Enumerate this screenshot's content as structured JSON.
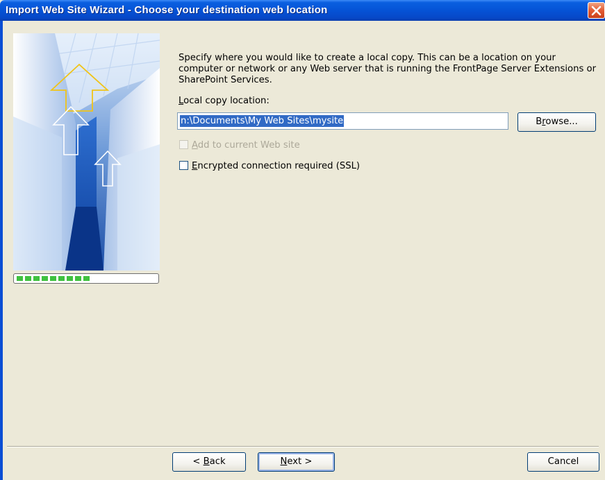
{
  "window": {
    "title": "Import Web Site Wizard - Choose your destination web location",
    "close_icon": "close-icon"
  },
  "progress": {
    "completed_steps": 9,
    "label": "wizard-progress"
  },
  "main": {
    "description": "Specify where you would like to create a local copy.  This can be a location on your computer or network or any Web server that is running the FrontPage Server Extensions or SharePoint Services.",
    "local_copy_label_prefix": "L",
    "local_copy_label_rest": "ocal copy location:",
    "local_copy_value": "n:\\Documents\\My Web Sites\\mysite",
    "browse_prefix": "B",
    "browse_u": "r",
    "browse_rest": "owse...",
    "add_to_current_u": "A",
    "add_to_current_rest": "dd to current Web site",
    "add_to_current_checked": false,
    "add_to_current_enabled": false,
    "ssl_u": "E",
    "ssl_rest": "ncrypted connection required (SSL)",
    "ssl_checked": false
  },
  "footer": {
    "back_prefix": "< ",
    "back_u": "B",
    "back_rest": "ack",
    "next_u": "N",
    "next_rest": "ext >",
    "cancel_label": "Cancel"
  },
  "colors": {
    "titlebar": "#0553d6",
    "selection": "#316ac5",
    "progress_fill": "#3fc13f",
    "dialog_bg": "#ece9d8"
  }
}
